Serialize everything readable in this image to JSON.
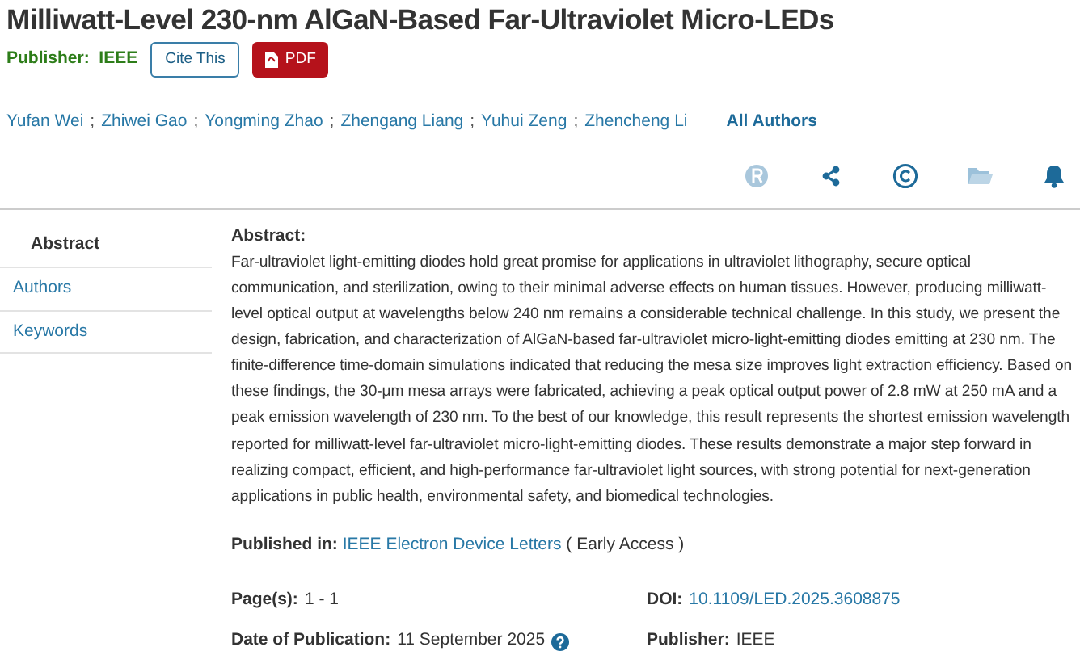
{
  "title": "Milliwatt-Level 230-nm AlGaN-Based Far-Ultraviolet Micro-LEDs",
  "publisher_line": {
    "label": "Publisher:",
    "value": "IEEE"
  },
  "buttons": [
    {
      "kind": "outline",
      "label": "Cite This"
    },
    {
      "kind": "pdf",
      "label": "PDF"
    }
  ],
  "authors": [
    "Yufan Wei",
    "Zhiwei Gao",
    "Yongming Zhao",
    "Zhengang Liang",
    "Yuhui Zeng",
    "Zhencheng Li"
  ],
  "author_separator": ";",
  "all_authors": "All Authors",
  "sidebar": [
    {
      "label": "Abstract",
      "selected": true
    },
    {
      "label": "Authors",
      "selected": false
    },
    {
      "label": "Keywords",
      "selected": false
    }
  ],
  "abstract": {
    "heading": "Abstract:",
    "text": "Far-ultraviolet light-emitting diodes hold great promise for applications in ultraviolet lithography, secure optical communication, and sterilization, owing to their minimal adverse effects on human tissues. However, producing milliwatt-level optical output at wavelengths below 240 nm remains a considerable technical challenge. In this study, we present the design, fabrication, and characterization of AlGaN-based far-ultraviolet micro-light-emitting diodes emitting at 230 nm. The finite-difference time-domain simulations indicated that reducing the mesa size improves light extraction efficiency. Based on these findings, the 30-μm mesa arrays were fabricated, achieving a peak optical output power of 2.8 mW at 250 mA and a peak emission wavelength of 230 nm. To the best of our knowledge, this result represents the shortest emission wavelength reported for milliwatt-level far-ultraviolet micro-light-emitting diodes. These results demonstrate a major step forward in realizing compact, efficient, and high-performance far-ultraviolet light sources, with strong potential for next-generation applications in public health, environmental safety, and biomedical technologies."
  },
  "published_in": {
    "label": "Published in:",
    "link": "IEEE Electron Device Letters",
    "note": "( Early Access )"
  },
  "details": {
    "pages": {
      "label": "Page(s):",
      "value": "1 - 1"
    },
    "doi": {
      "label": "DOI:",
      "link": "10.1109/LED.2025.3608875"
    },
    "date": {
      "label": "Date of Publication:",
      "value": "11 September 2025"
    },
    "publisher": {
      "label": "Publisher:",
      "value": "IEEE"
    }
  }
}
